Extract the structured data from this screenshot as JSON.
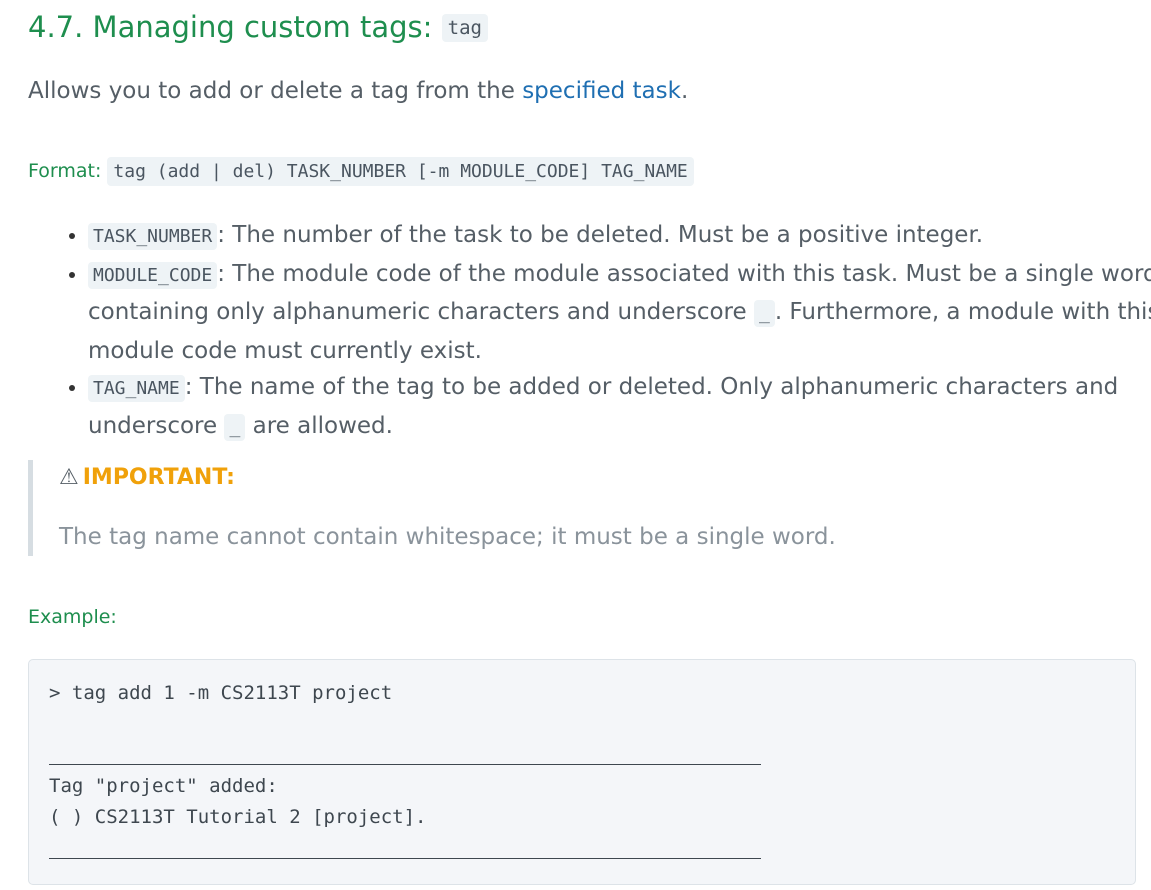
{
  "heading": {
    "text": "4.7. Managing custom tags:",
    "code": "tag"
  },
  "intro": {
    "text_before": "Allows you to add or delete a tag from the ",
    "link": "specified task",
    "text_after": "."
  },
  "format": {
    "label": "Format:",
    "code": "tag (add | del) TASK_NUMBER [-m MODULE_CODE] TAG_NAME"
  },
  "params": [
    {
      "code": "TASK_NUMBER",
      "text": ": The number of the task to be deleted. Must be a positive integer."
    },
    {
      "code": "MODULE_CODE",
      "text": ": The module code of the module associated with this task. Must be a single word containing only alphanumeric characters and underscore ",
      "code2": "_",
      "text2": ". Furthermore, a module with this module code must currently exist."
    },
    {
      "code": "TAG_NAME",
      "text": ": The name of the tag to be added or deleted. Only alphanumeric characters and underscore ",
      "code2": "_",
      "text2": " are allowed."
    }
  ],
  "callout": {
    "icon": "warning-icon",
    "glyph": "⚠",
    "title": "IMPORTANT:",
    "body": "The tag name cannot contain whitespace; it must be a single word."
  },
  "example": {
    "label": "Example:",
    "command": "> tag add 1 -m CS2113T project",
    "output_line1": "Tag \"project\" added:",
    "output_line2": "( ) CS2113T Tutorial 2 [project]."
  },
  "colors": {
    "heading": "#1e8e4e",
    "link": "#1f6fb2",
    "important": "#f0a10a",
    "code_bg": "#eef3f6"
  }
}
